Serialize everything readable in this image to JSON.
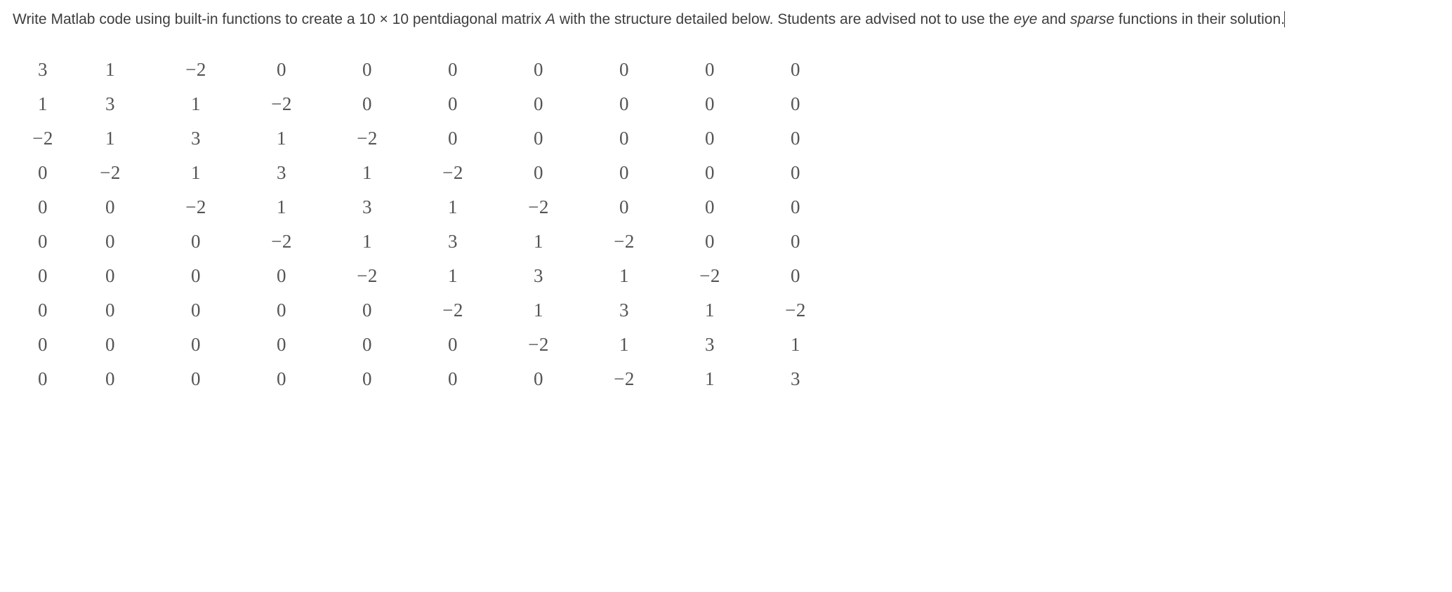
{
  "question": {
    "part1": "Write Matlab code using built-in functions to create a 10 × 10 pentdiagonal matrix ",
    "var": "A",
    "part2": " with the structure detailed below. Students are advised not to use the ",
    "ital1": "eye",
    "part3": " and ",
    "ital2": "sparse",
    "part4": " functions in their solution."
  },
  "chart_data": {
    "type": "table",
    "description": "10x10 pentadiagonal matrix",
    "rows": [
      [
        "3",
        "1",
        "−2",
        "0",
        "0",
        "0",
        "0",
        "0",
        "0",
        "0"
      ],
      [
        "1",
        "3",
        "1",
        "−2",
        "0",
        "0",
        "0",
        "0",
        "0",
        "0"
      ],
      [
        "−2",
        "1",
        "3",
        "1",
        "−2",
        "0",
        "0",
        "0",
        "0",
        "0"
      ],
      [
        "0",
        "−2",
        "1",
        "3",
        "1",
        "−2",
        "0",
        "0",
        "0",
        "0"
      ],
      [
        "0",
        "0",
        "−2",
        "1",
        "3",
        "1",
        "−2",
        "0",
        "0",
        "0"
      ],
      [
        "0",
        "0",
        "0",
        "−2",
        "1",
        "3",
        "1",
        "−2",
        "0",
        "0"
      ],
      [
        "0",
        "0",
        "0",
        "0",
        "−2",
        "1",
        "3",
        "1",
        "−2",
        "0"
      ],
      [
        "0",
        "0",
        "0",
        "0",
        "0",
        "−2",
        "1",
        "3",
        "1",
        "−2"
      ],
      [
        "0",
        "0",
        "0",
        "0",
        "0",
        "0",
        "−2",
        "1",
        "3",
        "1"
      ],
      [
        "0",
        "0",
        "0",
        "0",
        "0",
        "0",
        "0",
        "−2",
        "1",
        "3"
      ]
    ]
  }
}
